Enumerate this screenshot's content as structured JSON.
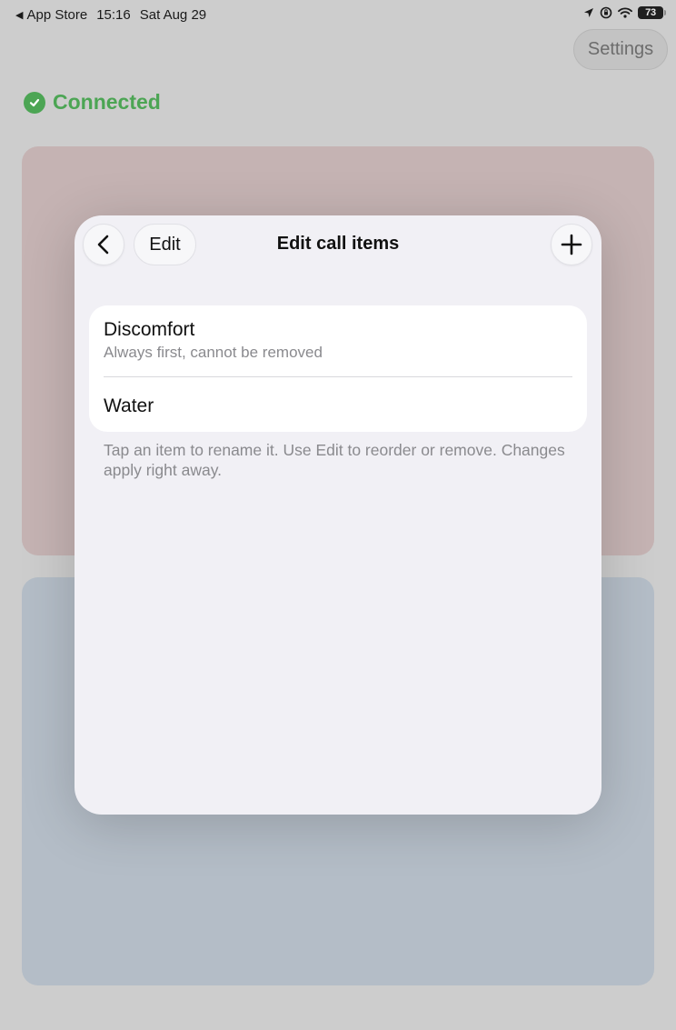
{
  "status_bar": {
    "back_app": "App Store",
    "time": "15:16",
    "date": "Sat Aug 29",
    "battery": "73",
    "icons": [
      "location-arrow-icon",
      "orientation-lock-icon",
      "wifi-icon",
      "battery-icon"
    ]
  },
  "header": {
    "settings_label": "Settings"
  },
  "connection": {
    "label": "Connected",
    "color": "#4ca554"
  },
  "sheet": {
    "title": "Edit call items",
    "edit_label": "Edit",
    "items": [
      {
        "title": "Discomfort",
        "subtitle": "Always first, cannot be removed"
      },
      {
        "title": "Water"
      }
    ],
    "footer": "Tap an item to rename it. Use Edit to reorder or remove. Changes apply right away."
  },
  "colors": {
    "background": "#cdcdcd",
    "card_red": "#c5b3b3",
    "card_blue": "#b4bdc7",
    "sheet": "#f1f0f5"
  }
}
